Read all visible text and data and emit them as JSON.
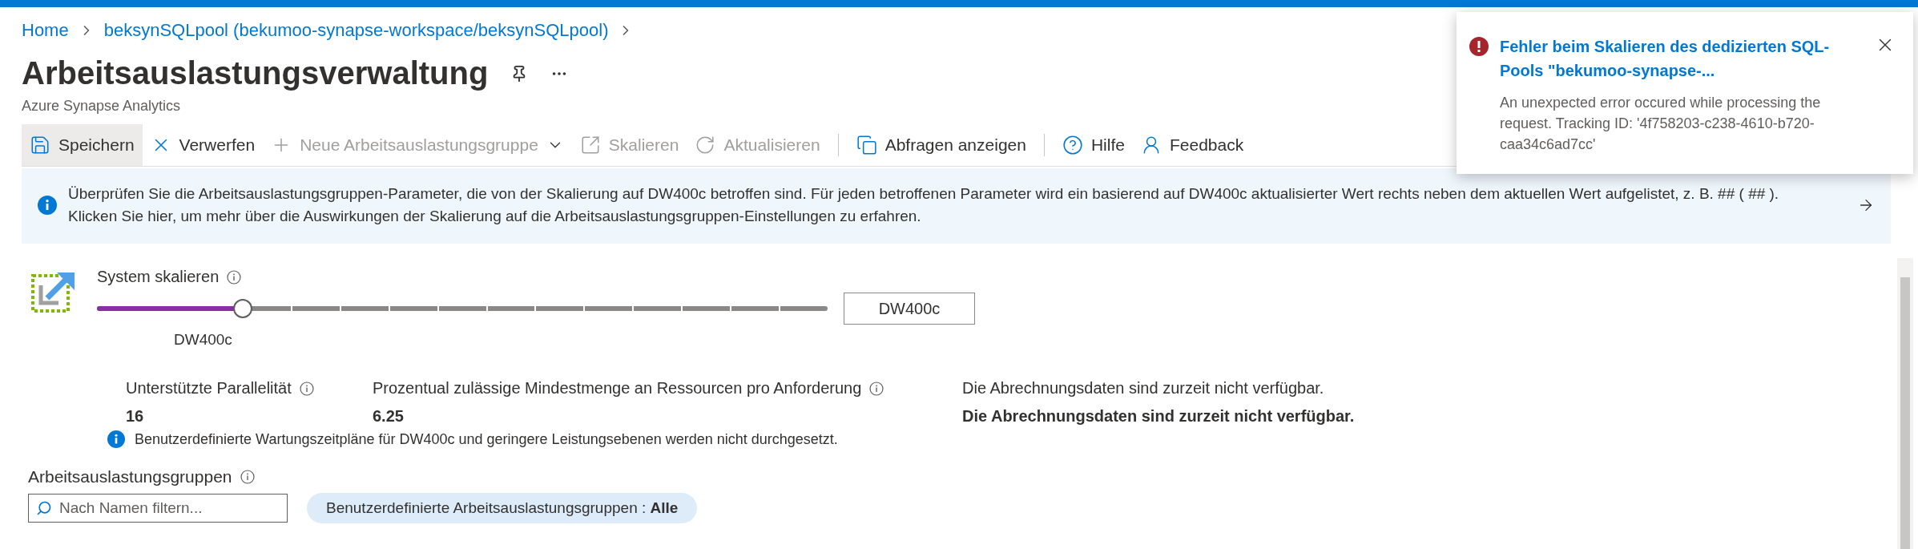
{
  "breadcrumb": [
    {
      "label": "Home"
    },
    {
      "label": "beksynSQLpool (bekumoo-synapse-workspace/beksynSQLpool)"
    }
  ],
  "page": {
    "title": "Arbeitsauslastungsverwaltung",
    "subtitle": "Azure Synapse Analytics"
  },
  "toolbar": [
    [
      {
        "label": "Speichern",
        "disabled": false,
        "selected": true,
        "dropdown": false
      },
      {
        "label": "Verwerfen",
        "disabled": false,
        "selected": false,
        "dropdown": false
      },
      {
        "label": "Neue Arbeitsauslastungsgruppe",
        "disabled": true,
        "selected": false,
        "dropdown": true
      },
      {
        "label": "Skalieren",
        "disabled": true,
        "selected": false,
        "dropdown": false
      },
      {
        "label": "Aktualisieren",
        "disabled": true,
        "selected": false,
        "dropdown": false
      }
    ],
    [
      {
        "label": "Abfragen anzeigen",
        "disabled": false,
        "selected": false,
        "dropdown": false
      }
    ],
    [
      {
        "label": "Hilfe",
        "disabled": false,
        "selected": false,
        "dropdown": false
      },
      {
        "label": "Feedback",
        "disabled": false,
        "selected": false,
        "dropdown": false
      }
    ]
  ],
  "banner": {
    "text": "Überprüfen Sie die Arbeitsauslastungsgruppen-Parameter, die von der Skalierung auf DW400c betroffen sind. Für jeden betroffenen Parameter wird ein basierend auf DW400c aktualisierter Wert rechts neben dem aktuellen Wert aufgelistet, z. B. ## ( ## ).",
    "link": "Klicken Sie hier, um mehr über die Auswirkungen der Skalierung auf die Arbeitsauslastungsgruppen-Einstellungen zu erfahren."
  },
  "scale": {
    "label": "System skalieren",
    "level": 0.2,
    "thumb_label": "DW400c",
    "value": "DW400c"
  },
  "stats": [
    {
      "label": "Unterstützte Parallelität",
      "info": true,
      "value": "16"
    },
    {
      "label": "Prozentual zulässige Mindestmenge an Ressourcen pro Anforderung",
      "info": true,
      "value": "6.25"
    },
    {
      "label": "Die Abrechnungsdaten sind zurzeit nicht verfügbar.",
      "info": false,
      "value": "Die Abrechnungsdaten sind zurzeit nicht verfügbar."
    }
  ],
  "notice": "Benutzerdefinierte Wartungszeitpläne für DW400c und geringere Leistungsebenen werden nicht durchgesetzt.",
  "groups": {
    "title": "Arbeitsauslastungsgruppen",
    "search": {
      "placeholder": "Nach Namen filtern..."
    },
    "filter": "Benutzerdefinierte Arbeitsauslastungsgruppen : **Alle**"
  },
  "notification": {
    "title": "Fehler beim Skalieren des dedizierten SQL-Pools \"bekumoo-synapse-...",
    "message": "An unexpected error occured while processing the request. Tracking ID: '4f758203-c238-4610-b720-caa34c6ad7cc'"
  }
}
